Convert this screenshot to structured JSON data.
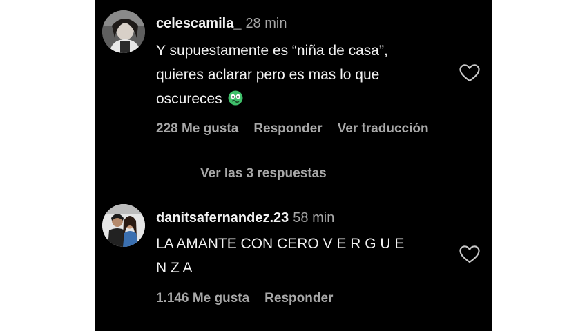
{
  "comments": [
    {
      "username": "celescamila_",
      "time": "28 min",
      "text_lines": [
        "Y supuestamente es “niña de casa”,",
        "quieres aclarar pero es mas lo que",
        "oscureces"
      ],
      "emoji": "nauseated-face",
      "likes": "228 Me gusta",
      "reply": "Responder",
      "translate": "Ver traducción"
    },
    {
      "username": "danitsafernandez.23",
      "time": "58 min",
      "text_lines": [
        "LA AMANTE CON CERO V E R G U E",
        "N Z A"
      ],
      "likes": "1.146 Me gusta",
      "reply": "Responder"
    }
  ],
  "replies_link": "Ver las 3 respuestas",
  "colors": {
    "background": "#000000",
    "primary_text": "#f2f2f2",
    "secondary_text": "#a8a8a8",
    "emoji_green": "#3fbf6a"
  }
}
